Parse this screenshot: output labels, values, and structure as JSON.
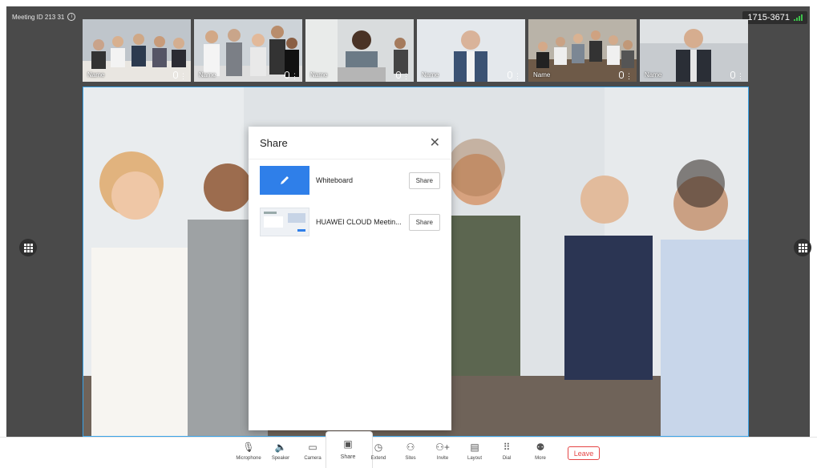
{
  "meeting": {
    "id_label": "Meeting ID 213 31",
    "room_number": "1715-3671"
  },
  "thumbnails": [
    {
      "name": "Name"
    },
    {
      "name": "Name"
    },
    {
      "name": "Name"
    },
    {
      "name": "Name"
    },
    {
      "name": "Name"
    },
    {
      "name": "Name"
    }
  ],
  "share_panel": {
    "title": "Share",
    "items": [
      {
        "label": "Whiteboard",
        "button": "Share"
      },
      {
        "label": "HUAWEI CLOUD Meetin...",
        "button": "Share"
      }
    ]
  },
  "toolbar": {
    "items": [
      {
        "label": "Microphone",
        "icon": "microphone-icon"
      },
      {
        "label": "Speaker",
        "icon": "speaker-icon"
      },
      {
        "label": "Camera",
        "icon": "camera-icon"
      },
      {
        "label": "Share",
        "icon": "share-screen-icon"
      },
      {
        "label": "Extend",
        "icon": "timer-icon"
      },
      {
        "label": "Sites",
        "icon": "person-icon"
      },
      {
        "label": "Invite",
        "icon": "add-person-icon"
      },
      {
        "label": "Layout",
        "icon": "layout-icon"
      },
      {
        "label": "Dial",
        "icon": "dialpad-icon"
      },
      {
        "label": "More",
        "icon": "more-icon"
      }
    ],
    "leave": "Leave"
  },
  "colors": {
    "accent": "#2f7fe9",
    "leave": "#e54545",
    "stage": "#4a4a4a",
    "active_border": "#3aa3e8"
  }
}
